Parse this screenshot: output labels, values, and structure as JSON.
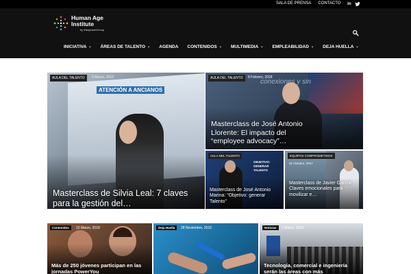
{
  "topbar": {
    "press_link": "SALA DE PRENSA",
    "contact_link": "CONTACTO"
  },
  "logo": {
    "line1": "Human Age",
    "line2": "Institute",
    "byline": "by ManpowerGroup"
  },
  "nav": {
    "items": [
      {
        "label": "INICIATIVA"
      },
      {
        "label": "ÁREAS DE TALENTO"
      },
      {
        "label": "AGENDA"
      },
      {
        "label": "CONTENIDOS"
      },
      {
        "label": "MULTIMEDIA"
      },
      {
        "label": "EMPLEABILIDAD"
      },
      {
        "label": "DEJA HUELLA"
      }
    ]
  },
  "featured": {
    "main": {
      "tag": "AULA DEL TALENTO",
      "date": "9 Marzo, 2018",
      "title": "Masterclass de Silvia Leal: 7 claves para la gestión del…",
      "image_text": "ATENCIÓN A ANCIANOS"
    },
    "top_right": {
      "tag": "AULA DEL TALENTO",
      "date": "8 Febrero, 2018",
      "title": "Masterclass de José Antonio Llorente: El impacto del “employee advocacy”…",
      "image_text": "conexiones y sin"
    },
    "small_left": {
      "tag": "AULA DEL TALENTO",
      "date": "",
      "title": "Masterclass de José Antonio Marina: “Objetivo: generar Talento”",
      "image_text": "OBJETIVO: GENERAR TALENTO"
    },
    "small_right": {
      "tag": "EQUIPOS COMPROMETIDOS",
      "date": "21 Octubre, 2017",
      "title": "Masterclass de Javier García: Claves emocionales para movilizar e…"
    }
  },
  "cards": [
    {
      "tag": "Contenidos",
      "date": "12 Marzo, 2018",
      "title": "Más de 250 jóvenes participan en las jornadas PowerYou"
    },
    {
      "tag": "Deja Huella",
      "date": "28 Noviembre, 2016",
      "title": ""
    },
    {
      "tag": "Noticias",
      "date": "1 Marzo, 2018",
      "title": "Tecnología, comercial e ingeniería serán las áreas con más"
    }
  ]
}
